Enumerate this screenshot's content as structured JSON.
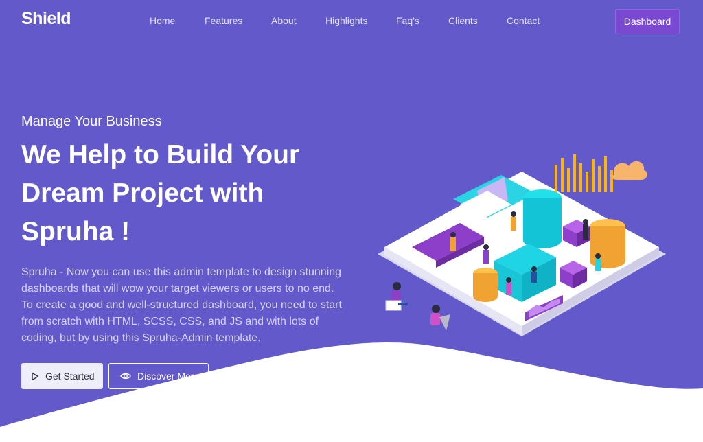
{
  "brand": {
    "name": "Shield"
  },
  "nav": {
    "items": [
      {
        "label": "Home"
      },
      {
        "label": "Features"
      },
      {
        "label": "About"
      },
      {
        "label": "Highlights"
      },
      {
        "label": "Faq's"
      },
      {
        "label": "Clients"
      },
      {
        "label": "Contact"
      }
    ],
    "dashboard_label": "Dashboard"
  },
  "hero": {
    "eyebrow": "Manage Your Business",
    "headline_lines": [
      "We Help to Build Your",
      "Dream Project with",
      "Spruha !"
    ],
    "description": "Spruha - Now you can use this admin template to design stunning dashboards that will wow your target viewers or users to no end. To create a good and well-structured dashboard, you need to start from scratch with HTML, SCSS, CSS, and JS and with lots of coding, but by using this Spruha-Admin template.",
    "buttons": {
      "get_started": {
        "label": "Get Started",
        "icon": "play-icon"
      },
      "discover_more": {
        "label": "Discover More",
        "icon": "eye-icon"
      }
    }
  },
  "colors": {
    "hero_bg": "#6259ca",
    "dashboard_button": "#7a49d2",
    "page_bg": "#ffffff"
  }
}
